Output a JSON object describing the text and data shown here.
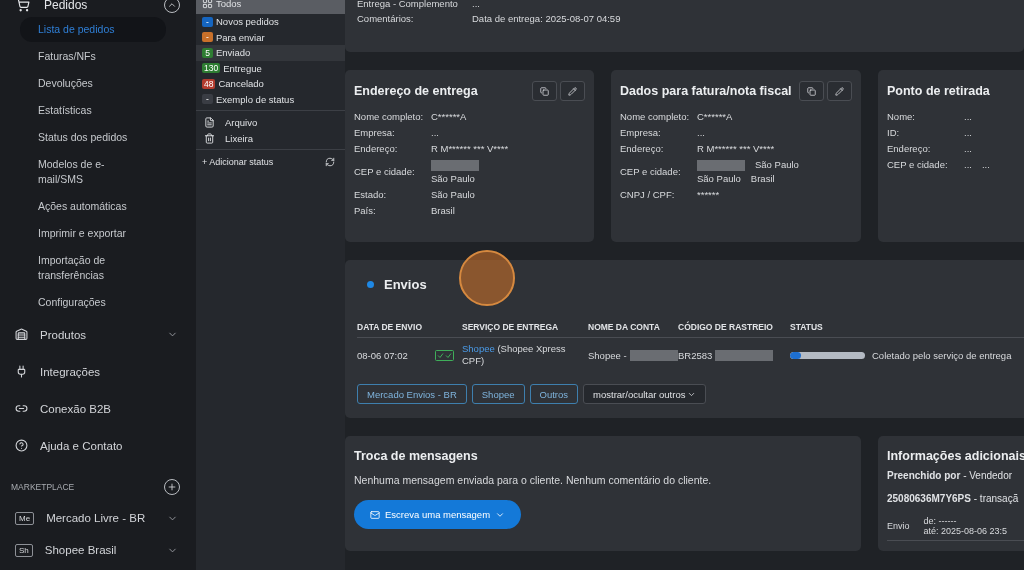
{
  "sidebar": {
    "section": {
      "label": "Pedidos",
      "expanded": true
    },
    "sub_items": [
      {
        "label": "Lista de pedidos",
        "selected": true
      },
      {
        "label": "Faturas/NFs",
        "selected": false
      },
      {
        "label": "Devoluções",
        "selected": false
      },
      {
        "label": "Estatísticas",
        "selected": false
      },
      {
        "label": "Status dos pedidos",
        "selected": false
      },
      {
        "label": "Modelos de e-mail/SMS",
        "selected": false
      },
      {
        "label": "Ações automáticas",
        "selected": false
      },
      {
        "label": "Imprimir e exportar",
        "selected": false
      },
      {
        "label": "Importação de transferências",
        "selected": false
      },
      {
        "label": "Configurações",
        "selected": false
      }
    ],
    "items": [
      {
        "label": "Produtos",
        "expandable": true
      },
      {
        "label": "Integrações",
        "expandable": false
      },
      {
        "label": "Conexão B2B",
        "expandable": false
      },
      {
        "label": "Ajuda e Contato",
        "expandable": false
      }
    ],
    "marketplace": {
      "title": "MARKETPLACE",
      "items": [
        {
          "badge": "Me",
          "label": "Mercado Livre - BR"
        },
        {
          "badge": "Sh",
          "label": "Shopee Brasil"
        }
      ]
    }
  },
  "status_panel": {
    "items": [
      {
        "kind": "all",
        "label": "Todos",
        "selected": true,
        "hovered": false
      },
      {
        "kind": "status",
        "badge": "-",
        "color": "#1565c0",
        "label": "Novos pedidos",
        "selected": false,
        "hovered": false
      },
      {
        "kind": "status",
        "badge": "-",
        "color": "#c8702a",
        "label": "Para enviar",
        "selected": false,
        "hovered": false
      },
      {
        "kind": "status",
        "badge": "5",
        "color": "#2e7d32",
        "label": "Enviado",
        "selected": false,
        "hovered": true
      },
      {
        "kind": "status",
        "badge": "130",
        "color": "#2e7d32",
        "label": "Entregue",
        "selected": false,
        "hovered": false
      },
      {
        "kind": "status",
        "badge": "48",
        "color": "#b23b2e",
        "label": "Cancelado",
        "selected": false,
        "hovered": false
      },
      {
        "kind": "status",
        "badge": "-",
        "color": "#3a3d44",
        "label": "Exemplo de status",
        "selected": false,
        "hovered": false
      }
    ],
    "archive": [
      {
        "label": "Arquivo"
      },
      {
        "label": "Lixeira"
      }
    ],
    "add_status": "+ Adicionar status"
  },
  "order_info": {
    "rows": [
      {
        "label": "Entrega - Complemento",
        "value": "..."
      },
      {
        "label": "Comentários:",
        "value": "Data de entrega: 2025-08-07 04:59"
      }
    ]
  },
  "address_cards": [
    {
      "title": "Endereço de entrega",
      "actions": true,
      "fields": [
        {
          "label": "Nome completo:",
          "lines": [
            [
              {
                "kind": "text",
                "text": "C******A"
              }
            ]
          ]
        },
        {
          "label": "Empresa:",
          "lines": [
            [
              {
                "kind": "text",
                "text": "..."
              }
            ]
          ]
        },
        {
          "label": "Endereço:",
          "lines": [
            [
              {
                "kind": "text",
                "text": "R M****** *** V****"
              }
            ]
          ]
        },
        {
          "label": "CEP e cidade:",
          "lines": [
            [
              {
                "kind": "redacted"
              }
            ],
            [
              {
                "kind": "text",
                "text": "São Paulo"
              }
            ]
          ]
        },
        {
          "label": "Estado:",
          "lines": [
            [
              {
                "kind": "text",
                "text": "São Paulo"
              }
            ]
          ]
        },
        {
          "label": "País:",
          "lines": [
            [
              {
                "kind": "text",
                "text": "Brasil"
              }
            ]
          ]
        }
      ]
    },
    {
      "title": "Dados para fatura/nota fiscal",
      "actions": true,
      "fields": [
        {
          "label": "Nome completo:",
          "lines": [
            [
              {
                "kind": "text",
                "text": "C******A"
              }
            ]
          ]
        },
        {
          "label": "Empresa:",
          "lines": [
            [
              {
                "kind": "text",
                "text": "..."
              }
            ]
          ]
        },
        {
          "label": "Endereço:",
          "lines": [
            [
              {
                "kind": "text",
                "text": "R M****** *** V****"
              }
            ]
          ]
        },
        {
          "label": "CEP e cidade:",
          "lines": [
            [
              {
                "kind": "redacted"
              },
              {
                "kind": "text",
                "text": "São Paulo"
              }
            ],
            [
              {
                "kind": "text",
                "text": "São Paulo"
              },
              {
                "kind": "text",
                "text": "Brasil"
              }
            ]
          ]
        },
        {
          "label": "CNPJ / CPF:",
          "lines": [
            [
              {
                "kind": "text",
                "text": "******"
              }
            ]
          ]
        }
      ]
    },
    {
      "title": "Ponto de retirada",
      "actions": false,
      "fields": [
        {
          "label": "Nome:",
          "lines": [
            [
              {
                "kind": "text",
                "text": "..."
              }
            ]
          ]
        },
        {
          "label": "ID:",
          "lines": [
            [
              {
                "kind": "text",
                "text": "..."
              }
            ]
          ]
        },
        {
          "label": "Endereço:",
          "lines": [
            [
              {
                "kind": "text",
                "text": "..."
              }
            ]
          ]
        },
        {
          "label": "CEP e cidade:",
          "lines": [
            [
              {
                "kind": "text",
                "text": "..."
              },
              {
                "kind": "text",
                "text": "..."
              }
            ]
          ]
        }
      ]
    }
  ],
  "shipments": {
    "title": "Envios",
    "columns": [
      "DATA DE ENVIO",
      "SERVIÇO DE ENTREGA",
      "NOME DA CONTA",
      "CÓDIGO DE RASTREIO",
      "STATUS"
    ],
    "rows": [
      {
        "date": "08-06 07:02",
        "service_link": "Shopee",
        "service_detail": "(Shopee Xpress CPF)",
        "account": "Shopee -",
        "tracking": "BR2583",
        "level": 0.15,
        "status": "Coletado pelo serviço de entrega"
      }
    ],
    "buttons": [
      {
        "kind": "filter",
        "label": "Mercado Envios - BR"
      },
      {
        "kind": "filter",
        "label": "Shopee"
      },
      {
        "kind": "filter",
        "label": "Outros"
      },
      {
        "kind": "dropdown",
        "label": "mostrar/ocultar outros"
      }
    ]
  },
  "messages": {
    "title": "Troca de mensagens",
    "text": "Nenhuma mensagem enviada para o cliente. Nenhum comentário do cliente.",
    "button": "Escreva uma mensagem"
  },
  "additional_info": {
    "title": "Informações adicionais",
    "lines": [
      "**Preenchido por** - Vendedor",
      "**25080636M7Y6PS** - transaçã"
    ],
    "shipping": {
      "label": "Envio",
      "from": "de: ------",
      "to": "até: 2025-08-06 23:5"
    }
  }
}
